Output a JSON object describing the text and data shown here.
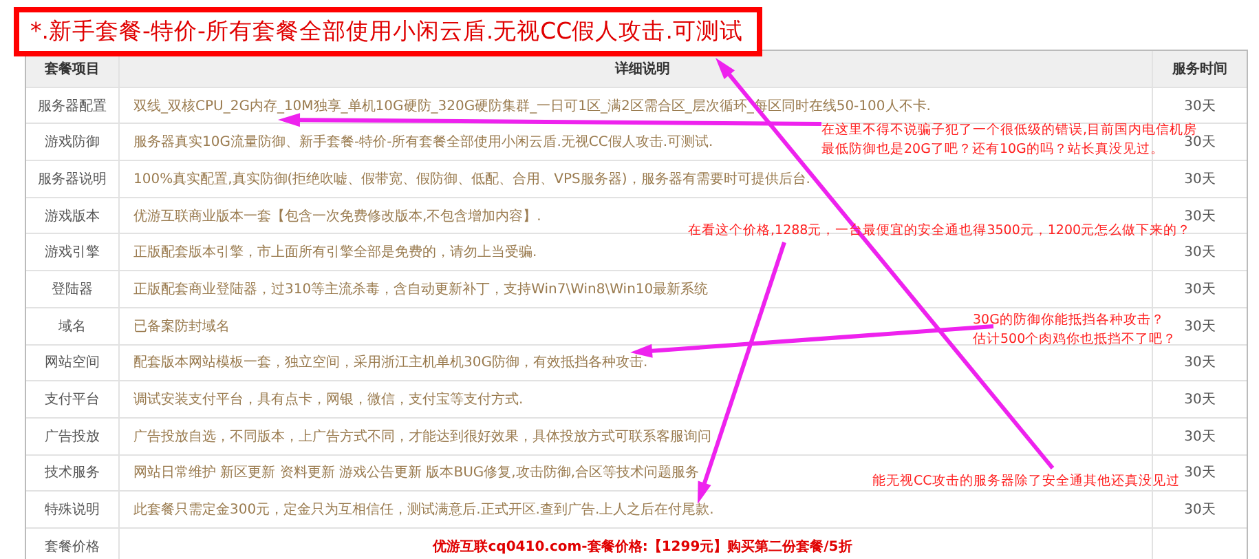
{
  "title": "*.新手套餐-特价-所有套餐全部使用小闲云盾.无视CC假人攻击.可测试",
  "table": {
    "columns": [
      "套餐项目",
      "详细说明",
      "服务时间"
    ],
    "rows": [
      {
        "item": "服务器配置",
        "detail": "双线_双核CPU_2G内存_10M独享_单机10G硬防_320G硬防集群_一日可1区_满2区需合区_层次循环_每区同时在线50-100人不卡.",
        "time": "30天"
      },
      {
        "item": "游戏防御",
        "detail": "服务器真实10G流量防御、新手套餐-特价-所有套餐全部使用小闲云盾.无视CC假人攻击.可测试.",
        "time": "30天"
      },
      {
        "item": "服务器说明",
        "detail": "100%真实配置,真实防御(拒绝吹嘘、假带宽、假防御、低配、合用、VPS服务器)，服务器有需要时可提供后台.",
        "time": "30天"
      },
      {
        "item": "游戏版本",
        "detail": "优游互联商业版本一套【包含一次免费修改版本,不包含增加内容】.",
        "time": "30天"
      },
      {
        "item": "游戏引擎",
        "detail": "正版配套版本引擎，市上面所有引擎全部是免费的，请勿上当受骗.",
        "time": "30天"
      },
      {
        "item": "登陆器",
        "detail": "正版配套商业登陆器，过310等主流杀毒，含自动更新补丁，支持Win7\\Win8\\Win10最新系统",
        "time": "30天"
      },
      {
        "item": "域名",
        "detail": "已备案防封域名",
        "time": "30天"
      },
      {
        "item": "网站空间",
        "detail": "配套版本网站模板一套，独立空间，采用浙江主机单机30G防御，有效抵挡各种攻击.",
        "time": "30天"
      },
      {
        "item": "支付平台",
        "detail": "调试安装支付平台，具有点卡，网银，微信，支付宝等支付方式.",
        "time": "30天"
      },
      {
        "item": "广告投放",
        "detail": "广告投放自选，不同版本，上广告方式不同，才能达到很好效果，具体投放方式可联系客服询问",
        "time": "30天"
      },
      {
        "item": "技术服务",
        "detail": "网站日常维护 新区更新 资料更新 游戏公告更新 版本BUG修复,攻击防御,合区等技术问题服务",
        "time": "30天"
      },
      {
        "item": "特殊说明",
        "detail": "此套餐只需定金300元，定金只为互相信任，测试满意后.正式开区.查到广告.上人之后在付尾款.",
        "time": "30天"
      }
    ],
    "price_row": {
      "item": "套餐价格",
      "detail": "优游互联cq0410.com-套餐价格:【1299元】购买第二份套餐/5折"
    }
  },
  "annotations": [
    {
      "lines": [
        "在这里不得不说骗子犯了一个很低级的错误,目前国内电信机房",
        "最低防御也是20G了吧？还有10G的吗？站长真没见过。"
      ]
    },
    {
      "lines": [
        "在看这个价格,1288元，一台最便宜的安全通也得3500元，1200元怎么做下来的？"
      ]
    },
    {
      "lines": [
        "30G的防御你能抵挡各种攻击？",
        "估计500个肉鸡你也抵挡不了吧？"
      ]
    },
    {
      "lines": [
        "能无视CC攻击的服务器除了安全通其他还真没见过"
      ]
    }
  ]
}
